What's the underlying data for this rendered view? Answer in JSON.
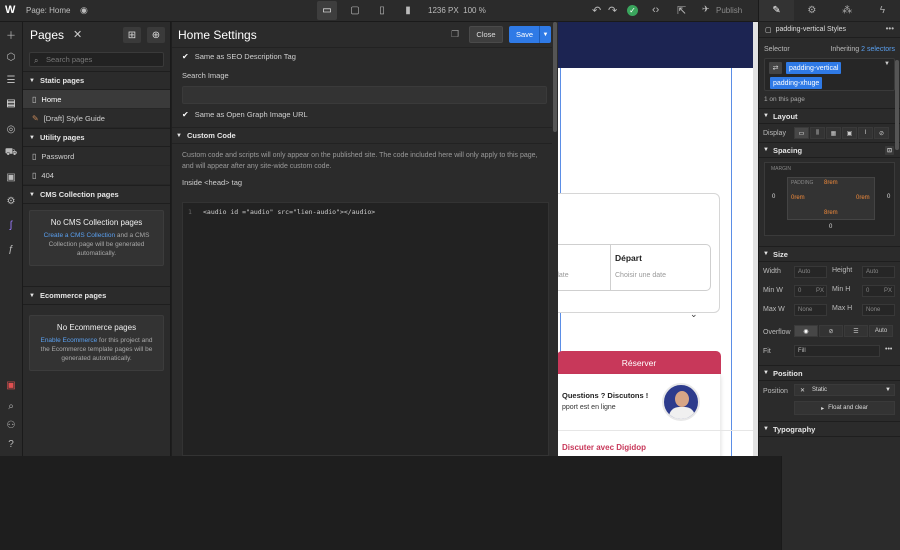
{
  "topbar": {
    "logo": "W",
    "page_label": "Page: Home",
    "canvas_size": "1236 PX",
    "zoom": "100 %",
    "publish": "Publish"
  },
  "pages_panel": {
    "title": "Pages",
    "search_placeholder": "Search pages",
    "static_pages_header": "Static pages",
    "static_pages": [
      {
        "label": "Home"
      },
      {
        "label": "[Draft] Style Guide"
      }
    ],
    "utility_pages_header": "Utility pages",
    "utility_pages": [
      {
        "label": "Password"
      },
      {
        "label": "404"
      }
    ],
    "cms_header": "CMS Collection pages",
    "cms_empty_title": "No CMS Collection pages",
    "cms_empty_link": "Create a CMS Collection",
    "cms_empty_text": "and a CMS Collection page will be generated automatically.",
    "ecom_header": "Ecommerce pages",
    "ecom_empty_title": "No Ecommerce pages",
    "ecom_empty_link": "Enable Ecommerce",
    "ecom_empty_text": "for this project and the Ecommerce template pages will be generated automatically."
  },
  "settings": {
    "title": "Home Settings",
    "close_label": "Close",
    "save_label": "Save",
    "same_as_seo": "Same as SEO Description Tag",
    "search_image_label": "Search Image",
    "same_as_og": "Same as Open Graph Image URL",
    "custom_code_header": "Custom Code",
    "custom_code_note": "Custom code and scripts will only appear on the published site. The code included here will only apply to this page, and will appear after any site-wide custom code.",
    "inside_head_label": "Inside <head> tag",
    "code_line_number": "1",
    "code_line": "<audio id =\"audio\" src=\"lien-audio\"></audio>"
  },
  "canvas": {
    "depart_title": "Départ",
    "depart_placeholder": "Choisir une date",
    "left_placeholder": "date",
    "reserver": "Réserver",
    "questions": "Questions ? Discutons !",
    "support": "pport est en ligne",
    "discuss": "Discuter avec Digidop"
  },
  "style_panel": {
    "title": "padding-vertical Styles",
    "selector_label": "Selector",
    "inheriting_prefix": "Inheriting",
    "inheriting_link": "2 selectors",
    "class_1": "padding-vertical",
    "class_2": "padding-xhuge",
    "on_this_page": "1 on this page",
    "layout_header": "Layout",
    "display_label": "Display",
    "spacing_header": "Spacing",
    "margin_label": "MARGIN",
    "padding_label": "PADDING",
    "margin_left": "0",
    "margin_right": "0",
    "margin_bottom": "0",
    "padding_top": "8rem",
    "padding_left": "0rem",
    "padding_right": "0rem",
    "padding_bottom": "8rem",
    "size_header": "Size",
    "width_label": "Width",
    "height_label": "Height",
    "min_w_label": "Min W",
    "min_h_label": "Min H",
    "max_w_label": "Max W",
    "max_h_label": "Max H",
    "auto": "Auto",
    "min_value": "0",
    "px": "PX",
    "none": "None",
    "overflow_label": "Overflow",
    "overflow_auto": "Auto",
    "fit_label": "Fit",
    "fit_value": "Fill",
    "position_header": "Position",
    "position_label": "Position",
    "position_value": "Static",
    "float_clear": "Float and clear",
    "typography_header": "Typography"
  }
}
